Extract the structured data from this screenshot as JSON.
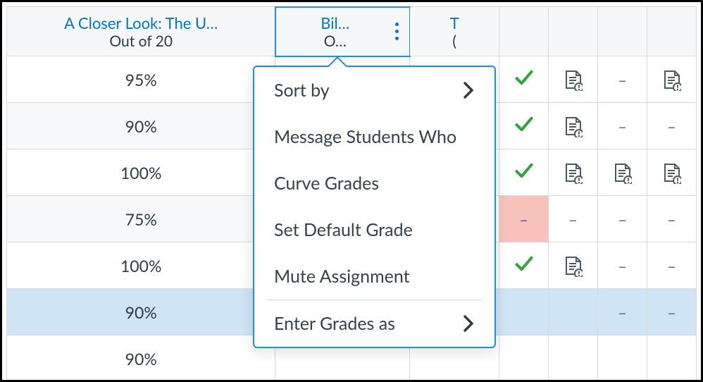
{
  "columns": {
    "c0": {
      "title": "A Closer Look: The U…",
      "subtitle": "Out of 20"
    },
    "c1": {
      "title": "Bil…",
      "subtitle": "O…"
    },
    "c2": {
      "title": "T",
      "subtitle": "("
    }
  },
  "rows": [
    {
      "grade": "95%",
      "status": "check",
      "cells": [
        "doc",
        "dash",
        "doc"
      ]
    },
    {
      "grade": "90%",
      "status": "check",
      "cells": [
        "doc",
        "dash",
        "dash"
      ]
    },
    {
      "grade": "100%",
      "status": "check",
      "cells": [
        "doc",
        "doc",
        "doc"
      ]
    },
    {
      "grade": "75%",
      "status": "missing",
      "cells": [
        "dash",
        "dash",
        "dash"
      ]
    },
    {
      "grade": "100%",
      "status": "check",
      "cells": [
        "doc",
        "dash",
        "dash"
      ]
    },
    {
      "grade": "90%",
      "status": "blank",
      "cells": [
        "blank",
        "dash",
        "dash"
      ],
      "highlight": true
    },
    {
      "grade": "90%",
      "status": "blank",
      "cells": [
        "blank",
        "blank",
        "blank"
      ]
    }
  ],
  "menu": {
    "sort_by": "Sort by",
    "message_students": "Message Students Who",
    "curve_grades": "Curve Grades",
    "set_default": "Set Default Grade",
    "mute_assignment": "Mute Assignment",
    "enter_grades_as": "Enter Grades as"
  },
  "symbols": {
    "dash": "–"
  }
}
